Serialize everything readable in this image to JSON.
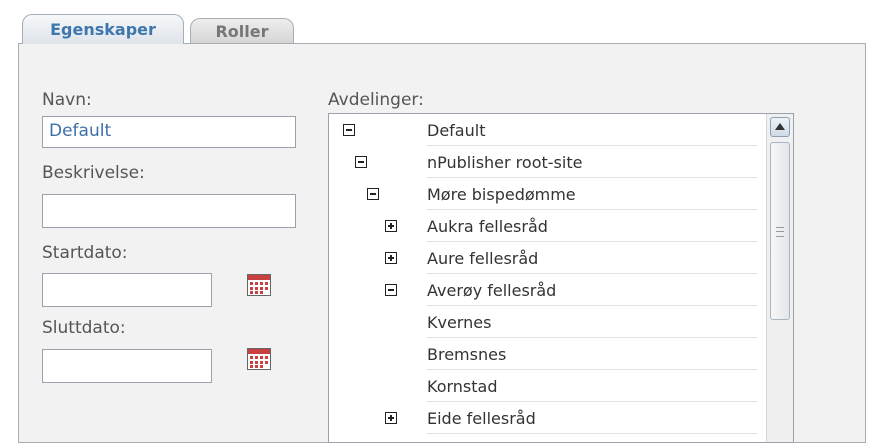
{
  "tabs": [
    {
      "label": "Egenskaper",
      "active": true
    },
    {
      "label": "Roller",
      "active": false
    }
  ],
  "form": {
    "name_label": "Navn:",
    "name_value": "Default",
    "description_label": "Beskrivelse:",
    "description_value": "",
    "start_label": "Startdato:",
    "start_value": "",
    "end_label": "Sluttdato:",
    "end_value": ""
  },
  "departments": {
    "label": "Avdelinger:",
    "items": [
      {
        "label": "Default",
        "toggle": "minus-square-icon"
      },
      {
        "label": "nPublisher root-site",
        "toggle": "minus-square-icon"
      },
      {
        "label": "Møre bispedømme",
        "toggle": "minus-square-icon"
      },
      {
        "label": "Aukra fellesråd",
        "toggle": "plus-square-icon"
      },
      {
        "label": "Aure fellesråd",
        "toggle": "plus-square-icon"
      },
      {
        "label": "Averøy fellesråd",
        "toggle": "minus-square-icon"
      },
      {
        "label": "Kvernes",
        "toggle": null
      },
      {
        "label": "Bremsnes",
        "toggle": null
      },
      {
        "label": "Kornstad",
        "toggle": null
      },
      {
        "label": "Eide fellesråd",
        "toggle": "plus-square-icon"
      }
    ]
  },
  "icons": {
    "calendar": "calendar-icon",
    "scroll_up": "scroll-up-arrow-icon"
  },
  "colors": {
    "active_tab_text": "#3e77ad",
    "inactive_tab_text": "#777777",
    "field_text": "#3e6fa8",
    "panel_bg": "#f2f2f2"
  }
}
